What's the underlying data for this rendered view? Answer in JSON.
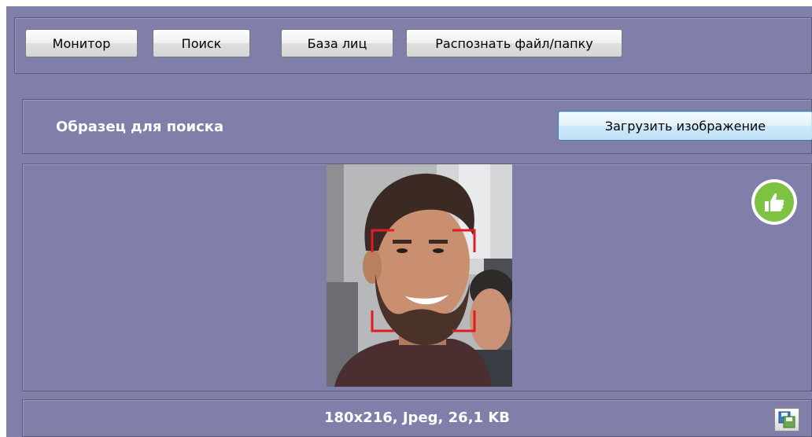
{
  "toolbar": {
    "buttons": [
      {
        "label": "Монитор"
      },
      {
        "label": "Поиск"
      },
      {
        "label": "База лиц"
      },
      {
        "label": "Распознать файл/папку"
      }
    ]
  },
  "sample": {
    "title": "Образец для поиска",
    "upload_label": "Загрузить изображение"
  },
  "image": {
    "info": "180x216, Jpeg, 26,1 KB",
    "status_icon": "thumbs-up-icon",
    "face_frame_color": "#e31b23"
  },
  "colors": {
    "app_background": "#7f7fa9",
    "accent_green": "#7dc242"
  }
}
